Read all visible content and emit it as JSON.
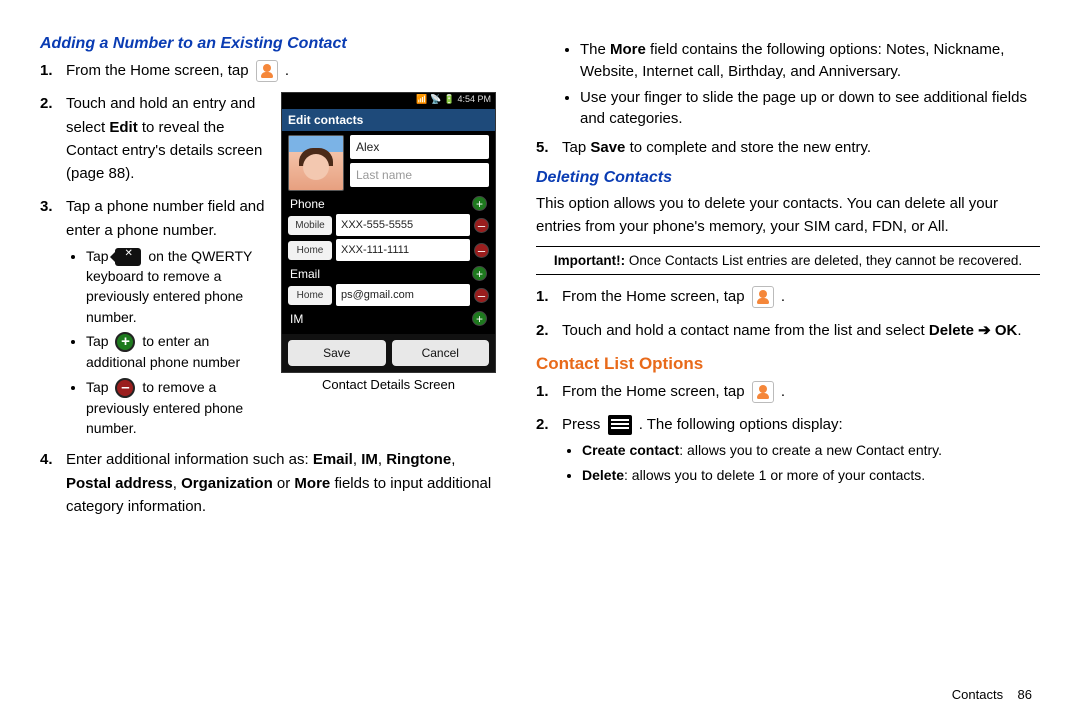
{
  "left": {
    "heading": "Adding a Number to an Existing Contact",
    "step1_pre": "From the Home screen, tap ",
    "step1_post": " .",
    "step2": "Touch and hold an entry and select ",
    "step2_bold": "Edit",
    "step2_b": " to reveal the Contact entry's details screen (page 88).",
    "step3": "Tap a phone number field and enter a phone number.",
    "b1_a": "Tap ",
    "b1_b": " on the QWERTY keyboard to remove a previously entered phone number.",
    "b2_a": "Tap ",
    "b2_b": " to enter an additional phone number",
    "b3_a": "Tap ",
    "b3_b": " to remove a previously entered phone number.",
    "step4_a": "Enter additional information such as: ",
    "step4_email": "Email",
    "step4_im": "IM",
    "step4_ring": "Ringtone",
    "step4_postal": "Postal address",
    "step4_org": "Organization",
    "step4_more": "More",
    "step4_b": " fields to input additional category information.",
    "caption": "Contact Details Screen"
  },
  "phone": {
    "statusbar": "4:54 PM",
    "title": "Edit contacts",
    "first_name": "Alex",
    "last_name_placeholder": "Last name",
    "phone_label": "Phone",
    "phone1_type": "Mobile",
    "phone1_val": "XXX-555-5555",
    "phone2_type": "Home",
    "phone2_val": "XXX-111-1111",
    "email_label": "Email",
    "email_type": "Home",
    "email_val": "ps@gmail.com",
    "im_label": "IM",
    "save": "Save",
    "cancel": "Cancel"
  },
  "right": {
    "bul_more_a": "The ",
    "bul_more_bold": "More",
    "bul_more_b": " field contains the following options: Notes, Nickname, Website, Internet call, Birthday, and Anniversary.",
    "bul_slide": "Use your finger to slide the page up or down to see additional fields and categories.",
    "step5_a": "Tap ",
    "step5_bold": "Save",
    "step5_b": " to complete and store the new entry.",
    "heading_del": "Deleting Contacts",
    "del_para": "This option allows you to delete your contacts. You can delete all your entries from your phone's memory, your SIM card, FDN, or All.",
    "important_label": "Important!:",
    "important_text": " Once Contacts List entries are deleted, they cannot be recovered.",
    "del_step1_a": "From the Home screen, tap ",
    "del_step1_b": " .",
    "del_step2_a": "Touch and hold a contact name from the list and select ",
    "del_step2_bold": "Delete ➔ OK",
    "del_step2_b": ".",
    "heading_clo": "Contact List Options",
    "clo_step1_a": "From the Home screen, tap ",
    "clo_step1_b": " .",
    "clo_step2_a": "Press ",
    "clo_step2_b": ". The following options display:",
    "clo_b1_bold": "Create contact",
    "clo_b1": ": allows you to create a new Contact entry.",
    "clo_b2_bold": "Delete",
    "clo_b2": ": allows you to delete 1 or more of your contacts."
  },
  "footer": {
    "label": "Contacts",
    "page": "86"
  }
}
